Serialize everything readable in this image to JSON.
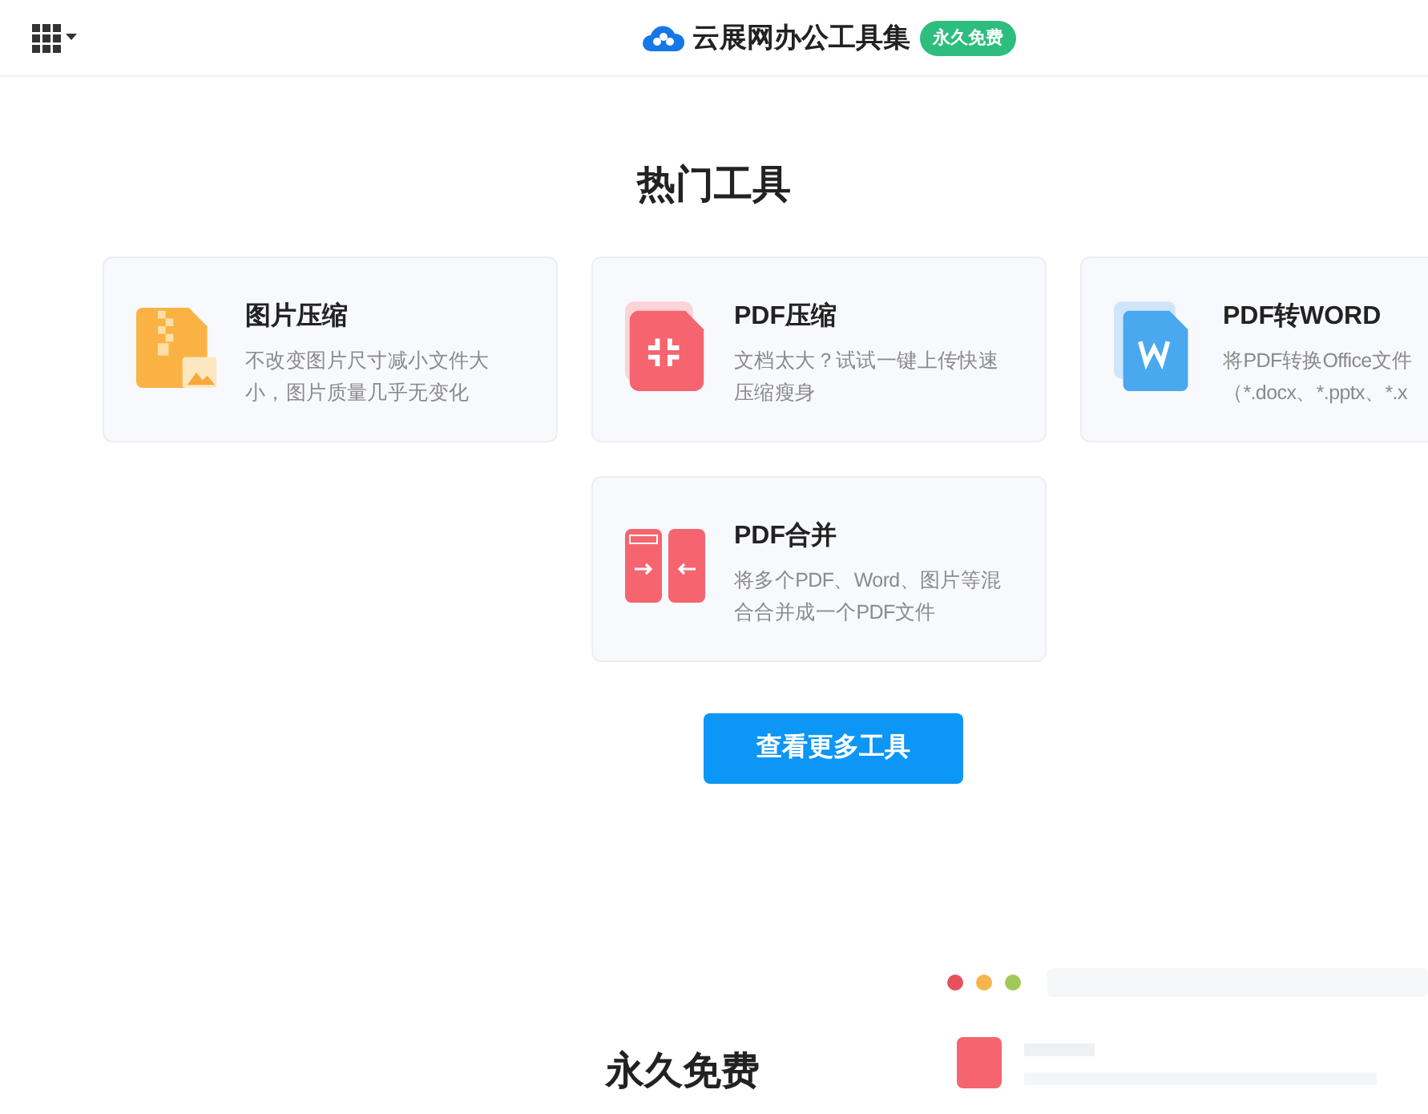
{
  "header": {
    "brand": "云展网办公工具集",
    "badge": "永久免费"
  },
  "section_title": "热门工具",
  "tools": [
    {
      "kind": "zip",
      "title": "图片压缩",
      "desc": [
        "不改变图片尺寸减小文件大",
        "小，图片质量几乎无变化"
      ]
    },
    {
      "kind": "compress",
      "title": "PDF压缩",
      "desc": [
        "文档太大？试试一键上传快速",
        "压缩瘦身"
      ]
    },
    {
      "kind": "word",
      "title": "PDF转WORD",
      "desc": [
        "将PDF转换Office文件",
        "（*.docx、*.pptx、*.x"
      ]
    },
    {
      "kind": "merge",
      "title": "PDF合并",
      "desc": [
        "将多个PDF、Word、图片等混",
        "合合并成一个PDF文件"
      ]
    }
  ],
  "more_button": "查看更多工具",
  "free_title": "永久免费"
}
